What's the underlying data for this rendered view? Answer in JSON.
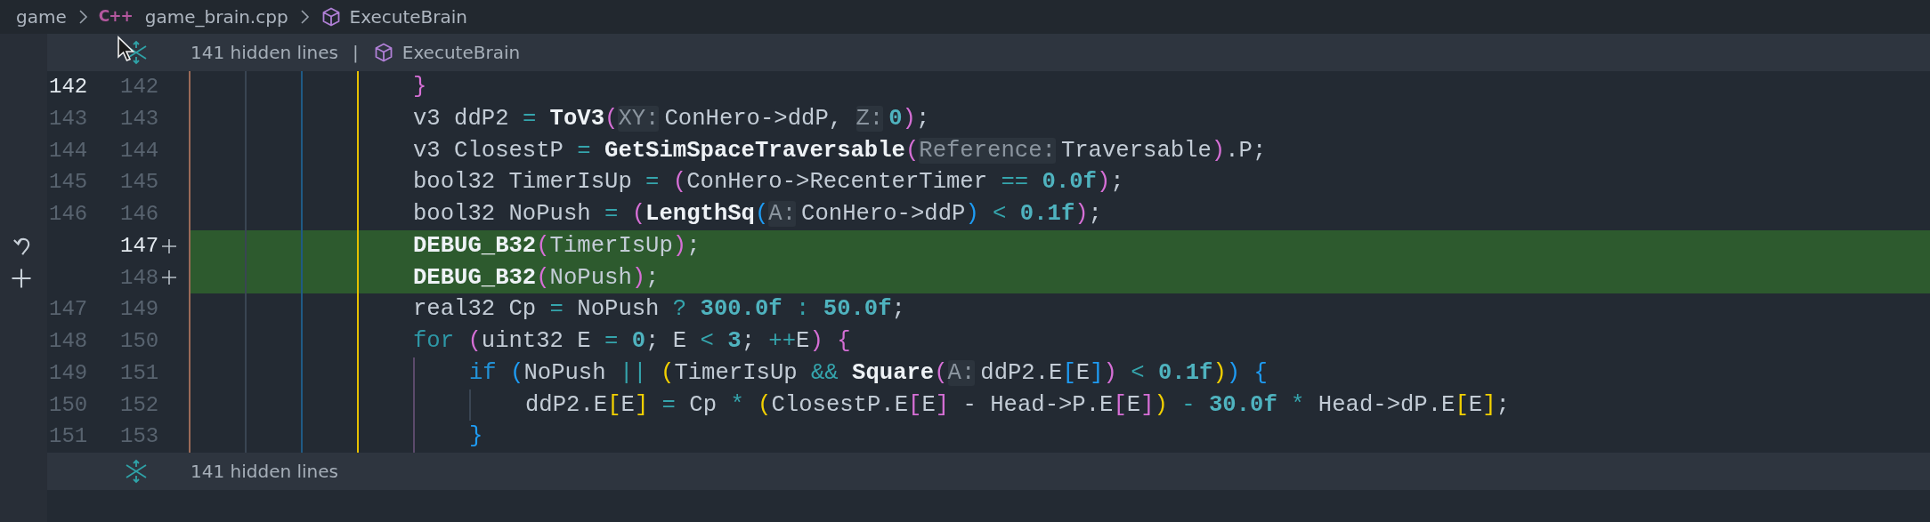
{
  "breadcrumb": [
    {
      "text": "game",
      "kind": "folder"
    },
    {
      "text": "game_brain.cpp",
      "kind": "file",
      "icon_text": "C++"
    },
    {
      "text": "ExecuteBrain",
      "kind": "symbol"
    }
  ],
  "top_fold": {
    "label": "141 hidden lines",
    "separator": "|",
    "symbol": "ExecuteBrain"
  },
  "lines": [
    {
      "kind": "context",
      "old": "142",
      "new": "142",
      "old_active": true,
      "new_active": false,
      "added": false,
      "tokens": [
        {
          "text": "}",
          "kind": "b1"
        }
      ]
    },
    {
      "kind": "context",
      "old": "143",
      "new": "143",
      "old_active": false,
      "new_active": false,
      "added": false,
      "tokens": [
        {
          "text": "v3 ddP2 ",
          "kind": "t"
        },
        {
          "text": "= ",
          "kind": "op"
        },
        {
          "text": "ToV3",
          "kind": "fn"
        },
        {
          "text": "(",
          "kind": "b1"
        },
        {
          "text": "XY:",
          "kind": "hint"
        },
        {
          "text": "ConHero->ddP, ",
          "kind": "t"
        },
        {
          "text": "Z:",
          "kind": "hint"
        },
        {
          "text": "0",
          "kind": "num"
        },
        {
          "text": ")",
          "kind": "b1"
        },
        {
          "text": ";",
          "kind": "t"
        }
      ]
    },
    {
      "kind": "context",
      "old": "144",
      "new": "144",
      "old_active": false,
      "new_active": false,
      "added": false,
      "tokens": [
        {
          "text": "v3 ClosestP ",
          "kind": "t"
        },
        {
          "text": "= ",
          "kind": "op"
        },
        {
          "text": "GetSimSpaceTraversable",
          "kind": "fn"
        },
        {
          "text": "(",
          "kind": "b1"
        },
        {
          "text": "Reference:",
          "kind": "hint"
        },
        {
          "text": "Traversable",
          "kind": "t"
        },
        {
          "text": ")",
          "kind": "b1"
        },
        {
          "text": ".P;",
          "kind": "t"
        }
      ]
    },
    {
      "kind": "context",
      "old": "145",
      "new": "145",
      "old_active": false,
      "new_active": false,
      "added": false,
      "tokens": [
        {
          "text": "bool32 TimerIsUp ",
          "kind": "t"
        },
        {
          "text": "= ",
          "kind": "op"
        },
        {
          "text": "(",
          "kind": "b1"
        },
        {
          "text": "ConHero->RecenterTimer ",
          "kind": "t"
        },
        {
          "text": "== ",
          "kind": "op"
        },
        {
          "text": "0.0f",
          "kind": "num"
        },
        {
          "text": ")",
          "kind": "b1"
        },
        {
          "text": ";",
          "kind": "t"
        }
      ]
    },
    {
      "kind": "context",
      "old": "146",
      "new": "146",
      "old_active": false,
      "new_active": false,
      "added": false,
      "tokens": [
        {
          "text": "bool32 NoPush ",
          "kind": "t"
        },
        {
          "text": "= ",
          "kind": "op"
        },
        {
          "text": "(",
          "kind": "b1"
        },
        {
          "text": "LengthSq",
          "kind": "fn"
        },
        {
          "text": "(",
          "kind": "b2"
        },
        {
          "text": "A:",
          "kind": "hint"
        },
        {
          "text": "ConHero->ddP",
          "kind": "t"
        },
        {
          "text": ")",
          "kind": "b2"
        },
        {
          "text": " < ",
          "kind": "op"
        },
        {
          "text": "0.1f",
          "kind": "num"
        },
        {
          "text": ")",
          "kind": "b1"
        },
        {
          "text": ";",
          "kind": "t"
        }
      ]
    },
    {
      "kind": "revert",
      "new": "147",
      "new_active": true,
      "added": true,
      "tokens": [
        {
          "text": "DEBUG_B32",
          "kind": "fn"
        },
        {
          "text": "(",
          "kind": "b1"
        },
        {
          "text": "TimerIsUp",
          "kind": "t"
        },
        {
          "text": ")",
          "kind": "b1"
        },
        {
          "text": ";",
          "kind": "t"
        }
      ]
    },
    {
      "kind": "stage",
      "new": "148",
      "new_active": false,
      "added": true,
      "tokens": [
        {
          "text": "DEBUG_B32",
          "kind": "fn"
        },
        {
          "text": "(",
          "kind": "b1"
        },
        {
          "text": "NoPush",
          "kind": "t"
        },
        {
          "text": ")",
          "kind": "b1"
        },
        {
          "text": ";",
          "kind": "t"
        }
      ]
    },
    {
      "kind": "context",
      "old": "147",
      "new": "149",
      "old_active": false,
      "new_active": false,
      "added": false,
      "tokens": [
        {
          "text": "real32 Cp ",
          "kind": "t"
        },
        {
          "text": "=",
          "kind": "op"
        },
        {
          "text": " NoPush ",
          "kind": "t"
        },
        {
          "text": "? ",
          "kind": "op"
        },
        {
          "text": "300.0f",
          "kind": "num"
        },
        {
          "text": " : ",
          "kind": "op"
        },
        {
          "text": "50.0f",
          "kind": "num"
        },
        {
          "text": ";",
          "kind": "t"
        }
      ]
    },
    {
      "kind": "context",
      "old": "148",
      "new": "150",
      "old_active": false,
      "new_active": false,
      "added": false,
      "tokens": [
        {
          "text": "for ",
          "kind": "kw"
        },
        {
          "text": "(",
          "kind": "b1"
        },
        {
          "text": "uint32 E ",
          "kind": "t"
        },
        {
          "text": "= ",
          "kind": "op"
        },
        {
          "text": "0",
          "kind": "num"
        },
        {
          "text": "; E ",
          "kind": "t"
        },
        {
          "text": "< ",
          "kind": "op"
        },
        {
          "text": "3",
          "kind": "num"
        },
        {
          "text": "; ",
          "kind": "t"
        },
        {
          "text": "++",
          "kind": "op"
        },
        {
          "text": "E",
          "kind": "t"
        },
        {
          "text": ")",
          "kind": "b1"
        },
        {
          "text": " {",
          "kind": "b1"
        }
      ],
      "children": [
        {
          "kind": "context",
          "old": "149",
          "new": "151",
          "old_active": false,
          "new_active": false,
          "added": false,
          "tokens": [
            {
              "text": "if ",
              "kind": "kw2"
            },
            {
              "text": "(",
              "kind": "b2"
            },
            {
              "text": "NoPush ",
              "kind": "t"
            },
            {
              "text": "|| ",
              "kind": "op"
            },
            {
              "text": "(",
              "kind": "b3"
            },
            {
              "text": "TimerIsUp ",
              "kind": "t"
            },
            {
              "text": "&& ",
              "kind": "op"
            },
            {
              "text": "Square",
              "kind": "fn"
            },
            {
              "text": "(",
              "kind": "b1"
            },
            {
              "text": "A:",
              "kind": "hint"
            },
            {
              "text": "ddP2.E",
              "kind": "t"
            },
            {
              "text": "[",
              "kind": "b2"
            },
            {
              "text": "E",
              "kind": "t"
            },
            {
              "text": "]",
              "kind": "b2"
            },
            {
              "text": ")",
              "kind": "b1"
            },
            {
              "text": " < ",
              "kind": "op"
            },
            {
              "text": "0.1f",
              "kind": "num"
            },
            {
              "text": ")",
              "kind": "b3"
            },
            {
              "text": ")",
              "kind": "b2"
            },
            {
              "text": " {",
              "kind": "b2"
            }
          ],
          "children": [
            {
              "kind": "context",
              "old": "150",
              "new": "152",
              "old_active": false,
              "new_active": false,
              "added": false,
              "tokens": [
                {
                  "text": "ddP2.E",
                  "kind": "t"
                },
                {
                  "text": "[",
                  "kind": "b3"
                },
                {
                  "text": "E",
                  "kind": "t"
                },
                {
                  "text": "]",
                  "kind": "b3"
                },
                {
                  "text": " = ",
                  "kind": "op"
                },
                {
                  "text": "Cp ",
                  "kind": "t"
                },
                {
                  "text": "* ",
                  "kind": "op"
                },
                {
                  "text": "(",
                  "kind": "b3"
                },
                {
                  "text": "ClosestP.E",
                  "kind": "t"
                },
                {
                  "text": "[",
                  "kind": "b1"
                },
                {
                  "text": "E",
                  "kind": "t"
                },
                {
                  "text": "]",
                  "kind": "b1"
                },
                {
                  "text": " - Head->P.E",
                  "kind": "t"
                },
                {
                  "text": "[",
                  "kind": "b1"
                },
                {
                  "text": "E",
                  "kind": "t"
                },
                {
                  "text": "]",
                  "kind": "b1"
                },
                {
                  "text": ")",
                  "kind": "b3"
                },
                {
                  "text": " - ",
                  "kind": "op"
                },
                {
                  "text": "30.0f",
                  "kind": "num"
                },
                {
                  "text": " * ",
                  "kind": "op"
                },
                {
                  "text": "Head->dP.E",
                  "kind": "t"
                },
                {
                  "text": "[",
                  "kind": "b3"
                },
                {
                  "text": "E",
                  "kind": "t"
                },
                {
                  "text": "]",
                  "kind": "b3"
                },
                {
                  "text": ";",
                  "kind": "t"
                }
              ]
            }
          ]
        },
        {
          "kind": "context",
          "old": "151",
          "new": "153",
          "old_active": false,
          "new_active": false,
          "added": false,
          "tokens": [
            {
              "text": "}",
              "kind": "b2"
            }
          ]
        }
      ]
    }
  ],
  "bottom_fold": {
    "label": "141 hidden lines"
  }
}
